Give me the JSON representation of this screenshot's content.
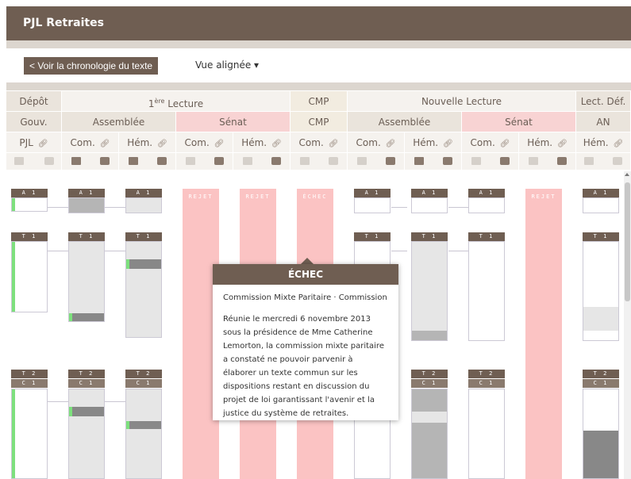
{
  "app_title": "PJL Retraites",
  "toolbar": {
    "back_label": "< Voir la chronologie du texte",
    "view_label": "Vue alignée ▾"
  },
  "header": {
    "row1": {
      "depot": "Dépôt",
      "lecture1_sup": "ère",
      "lecture1_num": "1",
      "lecture1_rest": " Lecture",
      "cmp": "CMP",
      "nouvelle": "Nouvelle Lecture",
      "lect_def": "Lect. Déf."
    },
    "row2": {
      "gouv": "Gouv.",
      "assemblee1": "Assemblée",
      "senat1": "Sénat",
      "cmp": "CMP",
      "assemblee2": "Assemblée",
      "senat2": "Sénat",
      "an": "AN"
    },
    "row3": [
      "PJL",
      "Com.",
      "Hém.",
      "Com.",
      "Hém.",
      "Com.",
      "Com.",
      "Hém.",
      "Com.",
      "Hém.",
      "Hém."
    ]
  },
  "columns": {
    "tag_a1": "A 1",
    "tag_t1": "T 1",
    "tag_t2": "T 2",
    "tag_c1": "C 1",
    "rejet": "REJET",
    "echec": "ÉCHEC"
  },
  "tooltip": {
    "title": "ÉCHEC",
    "subtitle": "Commission Mixte Paritaire · Commission",
    "text": "Réunie le mercredi 6 novembre 2013 sous la présidence de Mme Catherine Lemorton, la commission mixte paritaire a constaté ne pouvoir parvenir à élaborer un texte commun sur les dispositions restant en discussion du projet de loi garantissant l'avenir et la justice du système de retraites."
  }
}
